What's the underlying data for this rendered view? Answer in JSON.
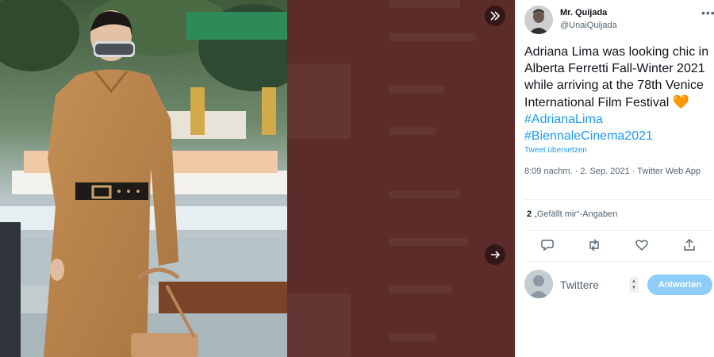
{
  "media": {
    "photo_alt_icon": "photo-of-woman-in-suede-jumpsuit",
    "collapse_icon": "double-chevron-right-icon",
    "next_icon": "arrow-right-icon"
  },
  "tweet": {
    "author_name": "Mr. Quijada",
    "author_handle": "@UnaiQuijada",
    "more_icon": "more-icon",
    "text_before": "Adriana Lima was looking chic in Alberta Ferretti Fall-Winter 2021 while arriving at the 78th Venice International Film Festival ",
    "emoji": "🧡",
    "hashtag_1": "#AdrianaLima",
    "hashtag_2": "#BiennaleCinema2021",
    "translate": "Tweet übersetzen",
    "timestamp": "8:09 nachm. · 2. Sep. 2021 · Twitter Web App",
    "likes_count": "2",
    "likes_label": "„Gefällt mir“-Angaben"
  },
  "actions": {
    "reply_icon": "reply-icon",
    "retweet_icon": "retweet-icon",
    "like_icon": "heart-icon",
    "share_icon": "share-icon"
  },
  "composer": {
    "placeholder": "Twittere",
    "button": "Antworten"
  },
  "colors": {
    "accent": "#1d9bf0",
    "button_disabled": "#8ecdf8",
    "backdrop": "#5b2c2a"
  }
}
